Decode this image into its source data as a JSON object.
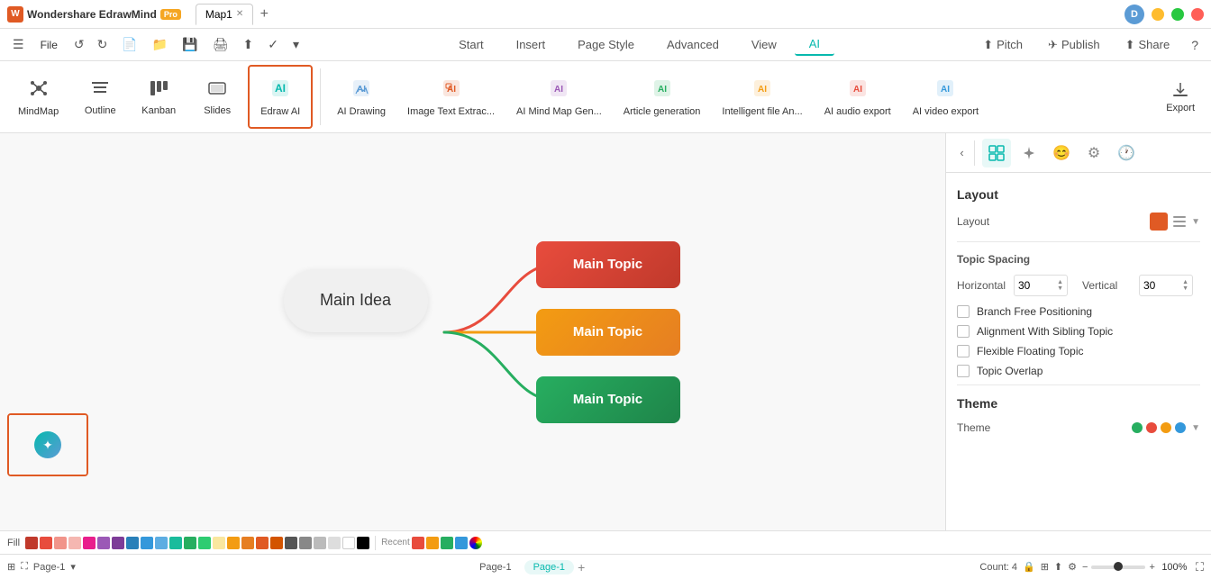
{
  "app": {
    "name": "Wondershare EdrawMind",
    "pro_badge": "Pro",
    "tab_name": "Map1",
    "avatar_letter": "D"
  },
  "menu": {
    "file": "File",
    "start": "Start",
    "insert": "Insert",
    "page_style": "Page Style",
    "advanced": "Advanced",
    "view": "View",
    "ai": "AI",
    "pitch": "Pitch",
    "publish": "Publish",
    "share": "Share"
  },
  "ribbon": {
    "items": [
      {
        "id": "mindmap",
        "label": "MindMap",
        "icon": "⊕"
      },
      {
        "id": "outline",
        "label": "Outline",
        "icon": "☰"
      },
      {
        "id": "kanban",
        "label": "Kanban",
        "icon": "⊞"
      },
      {
        "id": "slides",
        "label": "Slides",
        "icon": "▭"
      },
      {
        "id": "edraw-ai",
        "label": "Edraw AI",
        "icon": "✦",
        "selected": true
      },
      {
        "id": "ai-drawing",
        "label": "AI Drawing",
        "icon": "✦"
      },
      {
        "id": "image-text",
        "label": "Image Text Extrac...",
        "icon": "✦"
      },
      {
        "id": "ai-mindmap",
        "label": "AI Mind Map Gen...",
        "icon": "✦"
      },
      {
        "id": "article-gen",
        "label": "Article generation",
        "icon": "✦"
      },
      {
        "id": "intelligent-file",
        "label": "Intelligent file An...",
        "icon": "✦"
      },
      {
        "id": "ai-audio",
        "label": "AI audio export",
        "icon": "✦"
      },
      {
        "id": "ai-video",
        "label": "AI video export",
        "icon": "✦"
      }
    ],
    "export_label": "Export"
  },
  "canvas": {
    "central_node": "Main Idea",
    "topics": [
      {
        "label": "Main Topic",
        "color": "red",
        "style": "branch-red"
      },
      {
        "label": "Main Topic",
        "color": "yellow",
        "style": "branch-yellow"
      },
      {
        "label": "Main Topic",
        "color": "green",
        "style": "branch-green"
      }
    ]
  },
  "right_panel": {
    "sections": {
      "layout": {
        "title": "Layout",
        "layout_label": "Layout",
        "layout_color": "#e05a24"
      },
      "topic_spacing": {
        "title": "Topic Spacing",
        "horizontal_label": "Horizontal",
        "horizontal_value": "30",
        "vertical_label": "Vertical",
        "vertical_value": "30"
      },
      "checkboxes": [
        {
          "label": "Branch Free Positioning",
          "checked": false
        },
        {
          "label": "Alignment With Sibling Topic",
          "checked": false
        },
        {
          "label": "Flexible Floating Topic",
          "checked": false
        },
        {
          "label": "Topic Overlap",
          "checked": false
        }
      ],
      "theme": {
        "title": "Theme",
        "theme_label": "Theme"
      }
    }
  },
  "colors": {
    "primary": "#07b9ae",
    "accent": "#e05a24",
    "ai_active": "#07b9ae"
  },
  "status_bar": {
    "page_name": "Page-1",
    "page_tab": "Page-1",
    "count": "Count: 4",
    "zoom": "100%",
    "fit_icon": "⤢",
    "fullscreen_icon": "⛶"
  }
}
